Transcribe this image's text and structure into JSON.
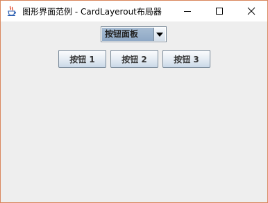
{
  "window": {
    "title": "图形界面范例 - CardLayerout布局器",
    "border_color": "#d9855a",
    "background": "#eeeeee",
    "controls": [
      "minimize-icon",
      "maximize-icon",
      "close-icon"
    ],
    "app_icon": "java-cup-icon"
  },
  "combo": {
    "selected": "按钮面板",
    "arrow_icon": "triangle-down-icon"
  },
  "buttons": [
    {
      "label": "按钮 1"
    },
    {
      "label": "按钮 2"
    },
    {
      "label": "按钮 3"
    }
  ]
}
